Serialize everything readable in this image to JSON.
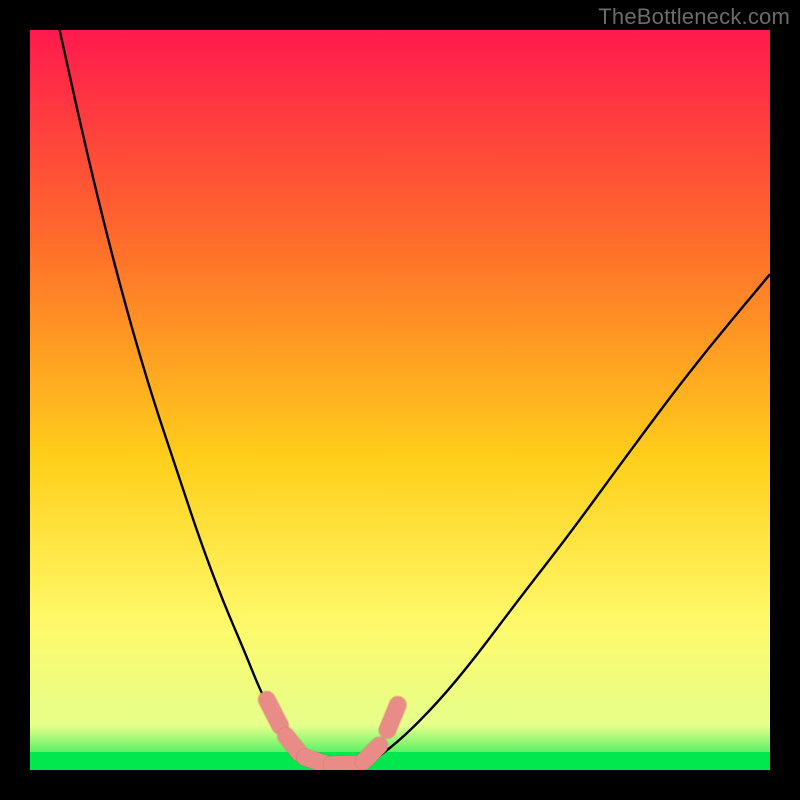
{
  "attribution": "TheBottleneck.com",
  "colors": {
    "frame": "#000000",
    "gradient_top": "#ff1a4d",
    "gradient_mid_upper": "#ff6a2b",
    "gradient_mid": "#ffcf1a",
    "gradient_lower": "#fff96a",
    "gradient_near_bottom": "#e6ff8a",
    "gradient_bottom": "#00e84e",
    "curve": "#000000",
    "marker_fill": "#e98b87",
    "marker_stroke": "#c9645f"
  },
  "chart_data": {
    "type": "line",
    "title": "",
    "xlabel": "",
    "ylabel": "",
    "xlim": [
      0,
      100
    ],
    "ylim": [
      0,
      100
    ],
    "note": "Two bottleneck curves (percent mismatch vs component balance). Values read from pixel positions; y is percent bottleneck (0 at green strip, 100 at top).",
    "series": [
      {
        "name": "left-curve",
        "x": [
          4,
          8,
          12,
          16,
          20,
          23,
          26,
          29,
          31,
          33,
          35,
          36.5,
          38
        ],
        "y": [
          100,
          82,
          66,
          52,
          40,
          31,
          23,
          16,
          11,
          7,
          4,
          2,
          1
        ]
      },
      {
        "name": "floor",
        "x": [
          38,
          40,
          42,
          44,
          46
        ],
        "y": [
          1,
          0.7,
          0.6,
          0.7,
          1
        ]
      },
      {
        "name": "right-curve",
        "x": [
          46,
          50,
          55,
          60,
          66,
          73,
          81,
          90,
          100
        ],
        "y": [
          1,
          4,
          9,
          15,
          23,
          32,
          43,
          55,
          67
        ]
      }
    ],
    "markers": {
      "name": "capsule-markers",
      "segments": [
        {
          "x1": 32.0,
          "y1": 9.5,
          "x2": 33.8,
          "y2": 6.0
        },
        {
          "x1": 34.6,
          "y1": 4.6,
          "x2": 36.4,
          "y2": 2.3
        },
        {
          "x1": 37.2,
          "y1": 1.7,
          "x2": 40.0,
          "y2": 0.8
        },
        {
          "x1": 40.8,
          "y1": 0.7,
          "x2": 44.3,
          "y2": 0.8
        },
        {
          "x1": 45.1,
          "y1": 1.2,
          "x2": 47.2,
          "y2": 3.3
        },
        {
          "x1": 48.3,
          "y1": 5.4,
          "x2": 49.7,
          "y2": 8.8
        }
      ]
    }
  }
}
